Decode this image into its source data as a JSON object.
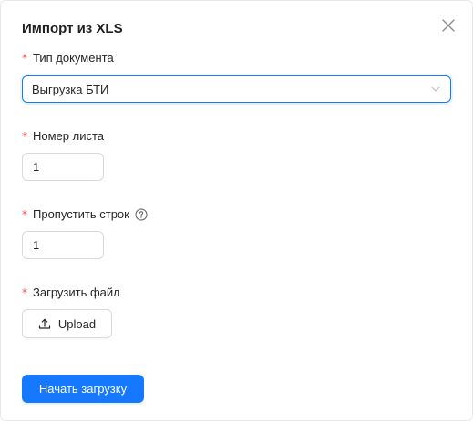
{
  "dialog": {
    "title": "Импорт из XLS"
  },
  "fields": {
    "doc_type": {
      "required_mark": "*",
      "label": "Тип документа",
      "value": "Выгрузка БТИ"
    },
    "sheet_number": {
      "required_mark": "*",
      "label": "Номер листа",
      "value": "1"
    },
    "skip_rows": {
      "required_mark": "*",
      "label": "Пропустить строк",
      "value": "1",
      "help_icon": "question-circle-icon"
    },
    "upload_file": {
      "required_mark": "*",
      "label": "Загрузить файл",
      "button_label": "Upload",
      "button_icon": "upload-icon"
    }
  },
  "actions": {
    "submit_label": "Начать загрузку"
  },
  "colors": {
    "primary": "#1677ff",
    "required": "#ff4d4f",
    "border": "#d9d9d9"
  }
}
